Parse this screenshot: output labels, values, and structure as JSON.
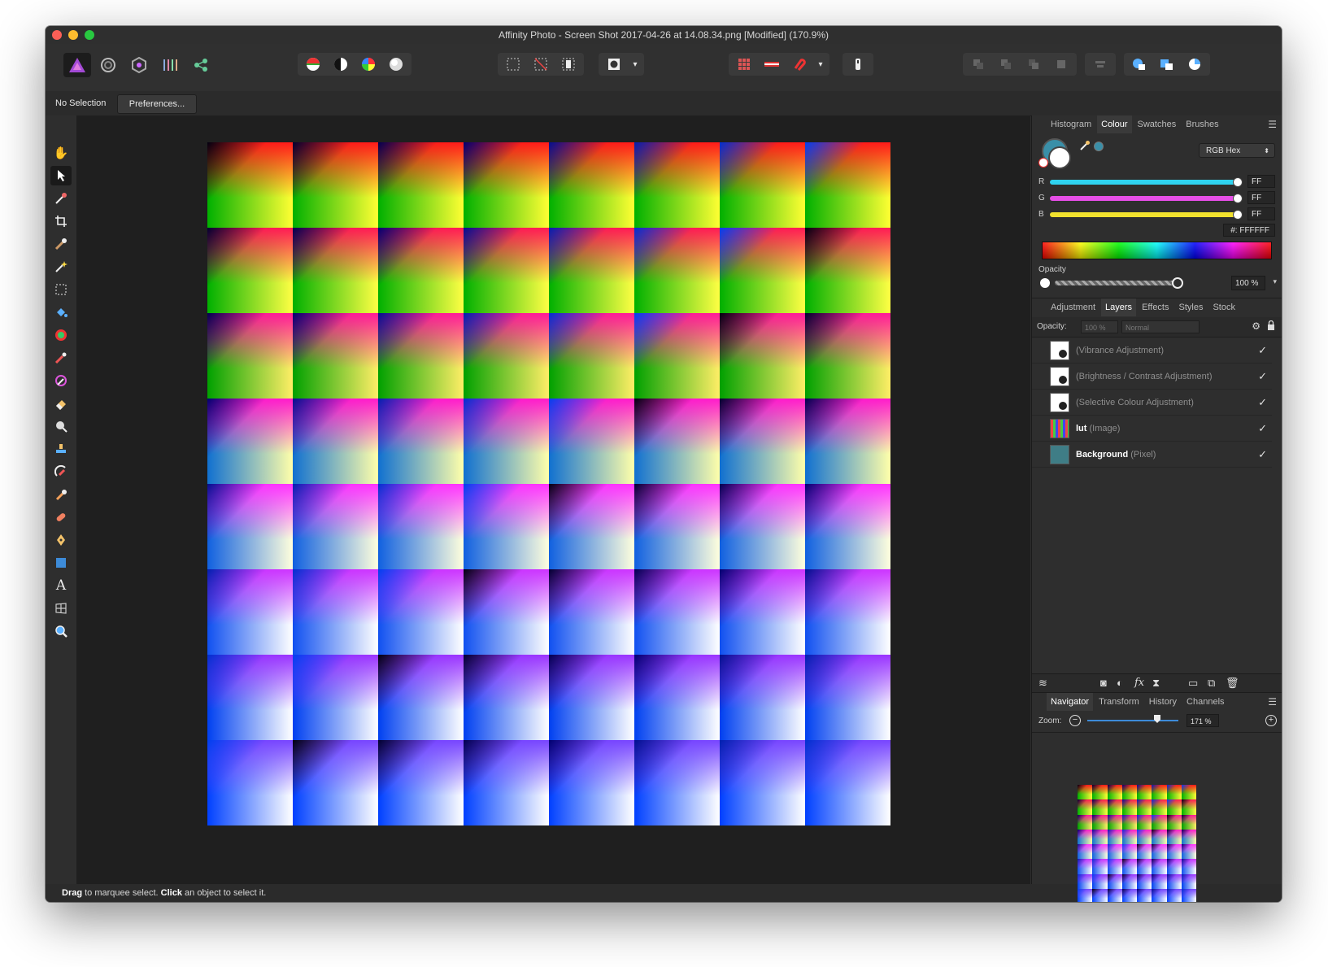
{
  "window": {
    "title": "Affinity Photo - Screen Shot 2017-04-26 at 14.08.34.png [Modified] (170.9%)"
  },
  "context_toolbar": {
    "selection_label": "No Selection",
    "preferences_button": "Preferences..."
  },
  "status": {
    "drag_word": "Drag",
    "drag_text": " to marquee select. ",
    "click_word": "Click",
    "click_text": " an object to select it."
  },
  "colour_panel": {
    "tabs": [
      "Histogram",
      "Colour",
      "Swatches",
      "Brushes"
    ],
    "active_tab": "Colour",
    "model": "RGB Hex",
    "channels": [
      {
        "label": "R",
        "value": "FF",
        "color": "#2fd3f0"
      },
      {
        "label": "G",
        "value": "FF",
        "color": "#e64ee6"
      },
      {
        "label": "B",
        "value": "FF",
        "color": "#f2e22e"
      }
    ],
    "hex_label": "#:",
    "hex_value": "FFFFFF",
    "opacity_label": "Opacity",
    "opacity_value": "100 %"
  },
  "layers_panel": {
    "tabs": [
      "Adjustment",
      "Layers",
      "Effects",
      "Styles",
      "Stock"
    ],
    "active_tab": "Layers",
    "opacity_label": "Opacity:",
    "opacity_value": "100 %",
    "blend_mode": "Normal",
    "layers": [
      {
        "name": "",
        "type": "(Vibrance Adjustment)"
      },
      {
        "name": "",
        "type": "(Brightness / Contrast Adjustment)"
      },
      {
        "name": "",
        "type": "(Selective Colour Adjustment)"
      },
      {
        "name": "lut",
        "type": "(Image)"
      },
      {
        "name": "Background",
        "type": "(Pixel)"
      }
    ]
  },
  "navigator_panel": {
    "tabs": [
      "Navigator",
      "Transform",
      "History",
      "Channels"
    ],
    "active_tab": "Navigator",
    "zoom_label": "Zoom:",
    "zoom_value": "171 %"
  },
  "colors": {
    "accent": "#3d8bd8"
  }
}
